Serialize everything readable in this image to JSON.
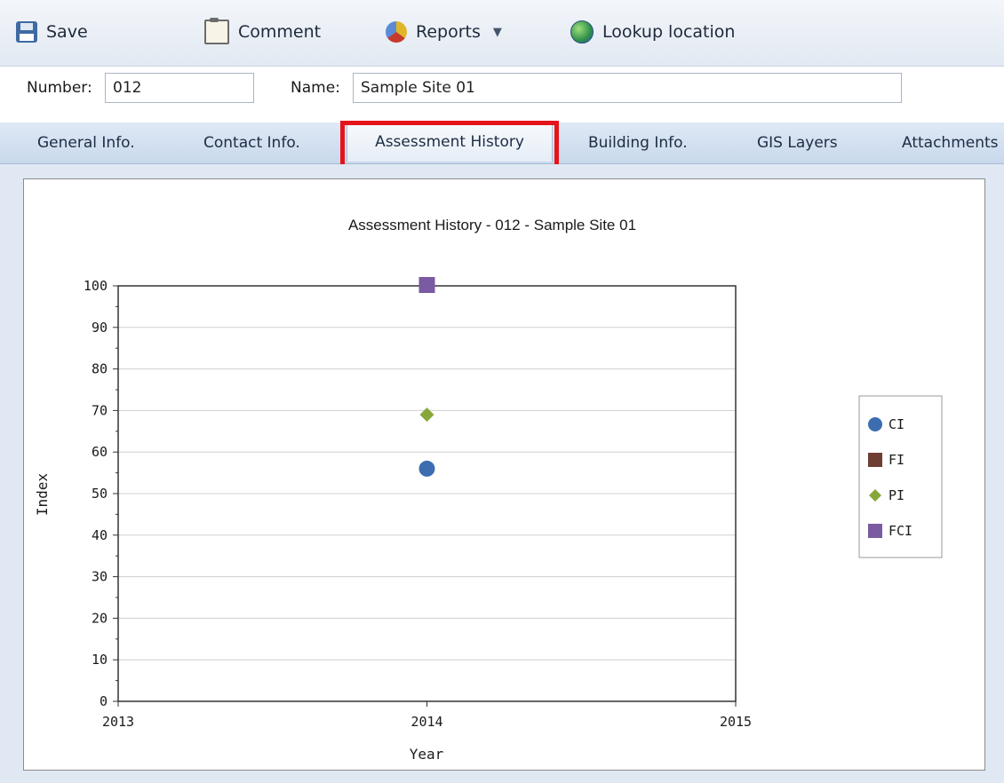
{
  "toolbar": {
    "save_label": "Save",
    "comment_label": "Comment",
    "reports_label": "Reports",
    "lookup_label": "Lookup location",
    "icons": [
      "save-icon",
      "comment-icon",
      "reports-icon",
      "globe-icon",
      "chevron-down-icon"
    ]
  },
  "fields": {
    "number_label": "Number:",
    "number_value": "012",
    "name_label": "Name:",
    "name_value": "Sample Site 01"
  },
  "tabs": [
    {
      "label": "General Info."
    },
    {
      "label": "Contact Info."
    },
    {
      "label": "Assessment History",
      "active": true
    },
    {
      "label": "Building Info."
    },
    {
      "label": "GIS Layers"
    },
    {
      "label": "Attachments"
    }
  ],
  "colors": {
    "highlight": "#e5141b",
    "ci": "#3c6db0",
    "fi": "#6e3e35",
    "pi": "#86a83a",
    "fci": "#7a5aa0"
  },
  "chart_data": {
    "type": "scatter",
    "title": "Assessment History - 012 - Sample Site 01",
    "xlabel": "Year",
    "ylabel": "Index",
    "xlim": [
      2013,
      2015
    ],
    "ylim": [
      0,
      100
    ],
    "x_ticks": [
      "2013",
      "2014",
      "2015"
    ],
    "y_ticks": [
      "0",
      "10",
      "20",
      "30",
      "40",
      "50",
      "60",
      "70",
      "80",
      "90",
      "100"
    ],
    "grid": true,
    "legend_position": "right",
    "series": [
      {
        "name": "CI",
        "marker": "circle",
        "color": "#3c6db0",
        "points": [
          {
            "x": 2014,
            "y": 56
          }
        ]
      },
      {
        "name": "FI",
        "marker": "square",
        "color": "#6e3e35",
        "points": [
          {
            "x": 2014,
            "y": 100
          }
        ]
      },
      {
        "name": "PI",
        "marker": "diamond",
        "color": "#86a83a",
        "points": [
          {
            "x": 2014,
            "y": 69
          }
        ]
      },
      {
        "name": "FCI",
        "marker": "square",
        "color": "#7a5aa0",
        "points": [
          {
            "x": 2014,
            "y": 100
          }
        ]
      }
    ]
  }
}
